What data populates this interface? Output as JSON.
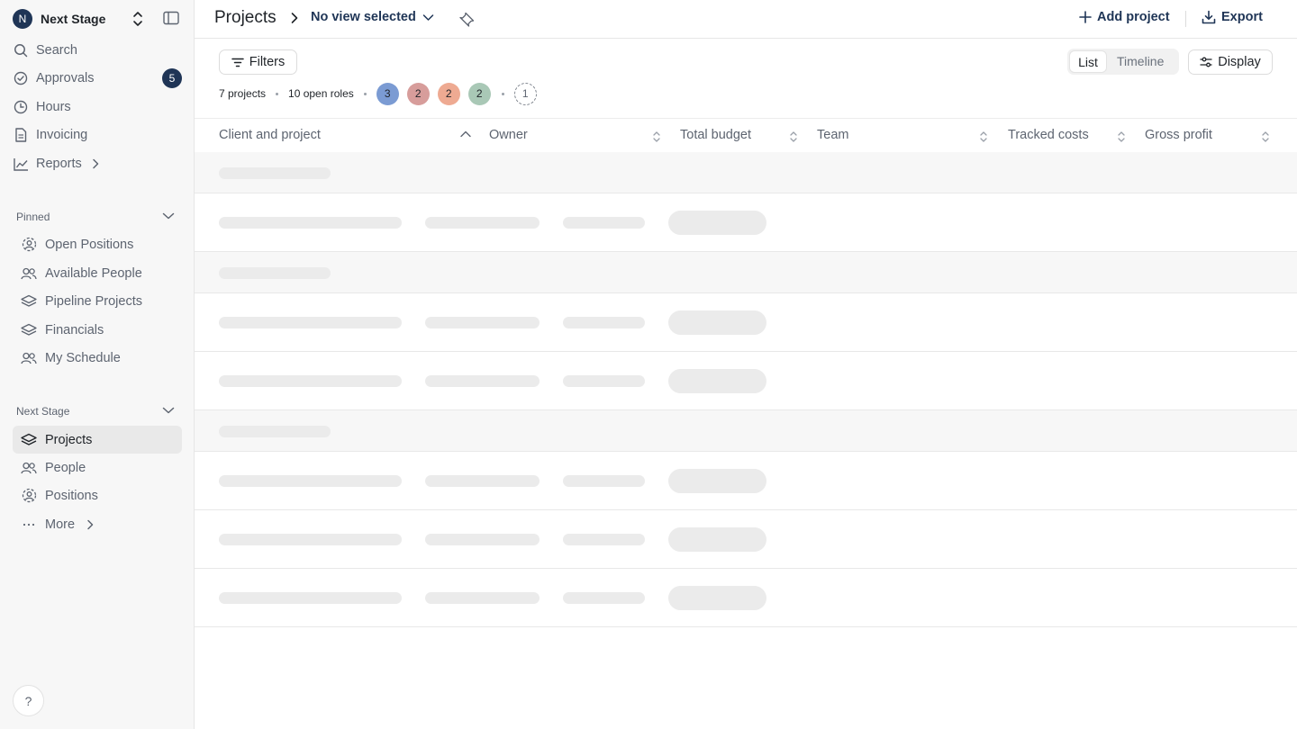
{
  "workspace": {
    "avatar_letter": "N",
    "name": "Next Stage"
  },
  "nav": {
    "search": "Search",
    "approvals": "Approvals",
    "approvals_badge": "5",
    "hours": "Hours",
    "invoicing": "Invoicing",
    "reports": "Reports"
  },
  "pinned": {
    "title": "Pinned",
    "items": [
      "Open Positions",
      "Available People",
      "Pipeline Projects",
      "Financials",
      "My Schedule"
    ]
  },
  "team_section": {
    "title": "Next Stage",
    "items": [
      "Projects",
      "People",
      "Positions",
      "More"
    ]
  },
  "help_label": "?",
  "header": {
    "title": "Projects",
    "view_selector": "No view selected",
    "add_project": "Add project",
    "export": "Export"
  },
  "toolbar": {
    "filters": "Filters",
    "view_list": "List",
    "view_timeline": "Timeline",
    "display": "Display"
  },
  "summary": {
    "projects": "7 projects",
    "open_roles": "10 open roles",
    "circles": [
      {
        "count": "3",
        "color": "#7b9bd3"
      },
      {
        "count": "2",
        "color": "#d79d9b"
      },
      {
        "count": "2",
        "color": "#eeaa92"
      },
      {
        "count": "2",
        "color": "#a9c8b6"
      }
    ],
    "unassigned": "1"
  },
  "table": {
    "columns": [
      "Client and project",
      "Owner",
      "Total budget",
      "Team",
      "Tracked costs",
      "Gross profit"
    ],
    "rows": [
      "group",
      "project",
      "group",
      "project",
      "project",
      "group",
      "project",
      "project",
      "project"
    ],
    "loading": true
  },
  "colors": {
    "accent": "#1f3556",
    "skeleton": "#ebebeb",
    "active_bg": "#e9e9e9"
  }
}
